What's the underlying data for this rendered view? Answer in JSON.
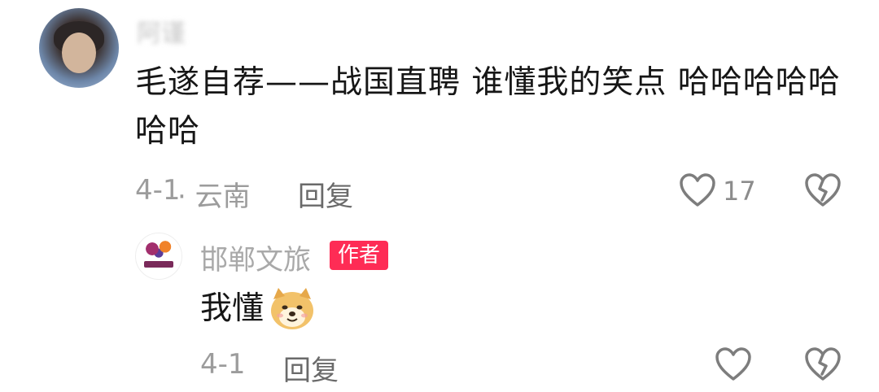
{
  "comment": {
    "username": "阿谨",
    "text": "毛遂自荐——战国直聘 谁懂我的笑点 哈哈哈哈哈哈哈",
    "date": "4-1",
    "location": "· 云南",
    "reply_label": "回复",
    "like_count": "17",
    "icons": {
      "avatar": "user-avatar",
      "like": "heart-outline-icon",
      "dislike": "broken-heart-icon"
    }
  },
  "reply": {
    "username": "邯郸文旅",
    "badge": "作者",
    "text": "我懂",
    "emoji": "doge-emoji",
    "date": "4-1",
    "reply_label": "回复",
    "icons": {
      "like": "heart-outline-icon",
      "dislike": "broken-heart-icon"
    }
  },
  "colors": {
    "badge_bg": "#fe2c55",
    "text_primary": "#161616",
    "text_secondary": "#9c9c9c"
  }
}
